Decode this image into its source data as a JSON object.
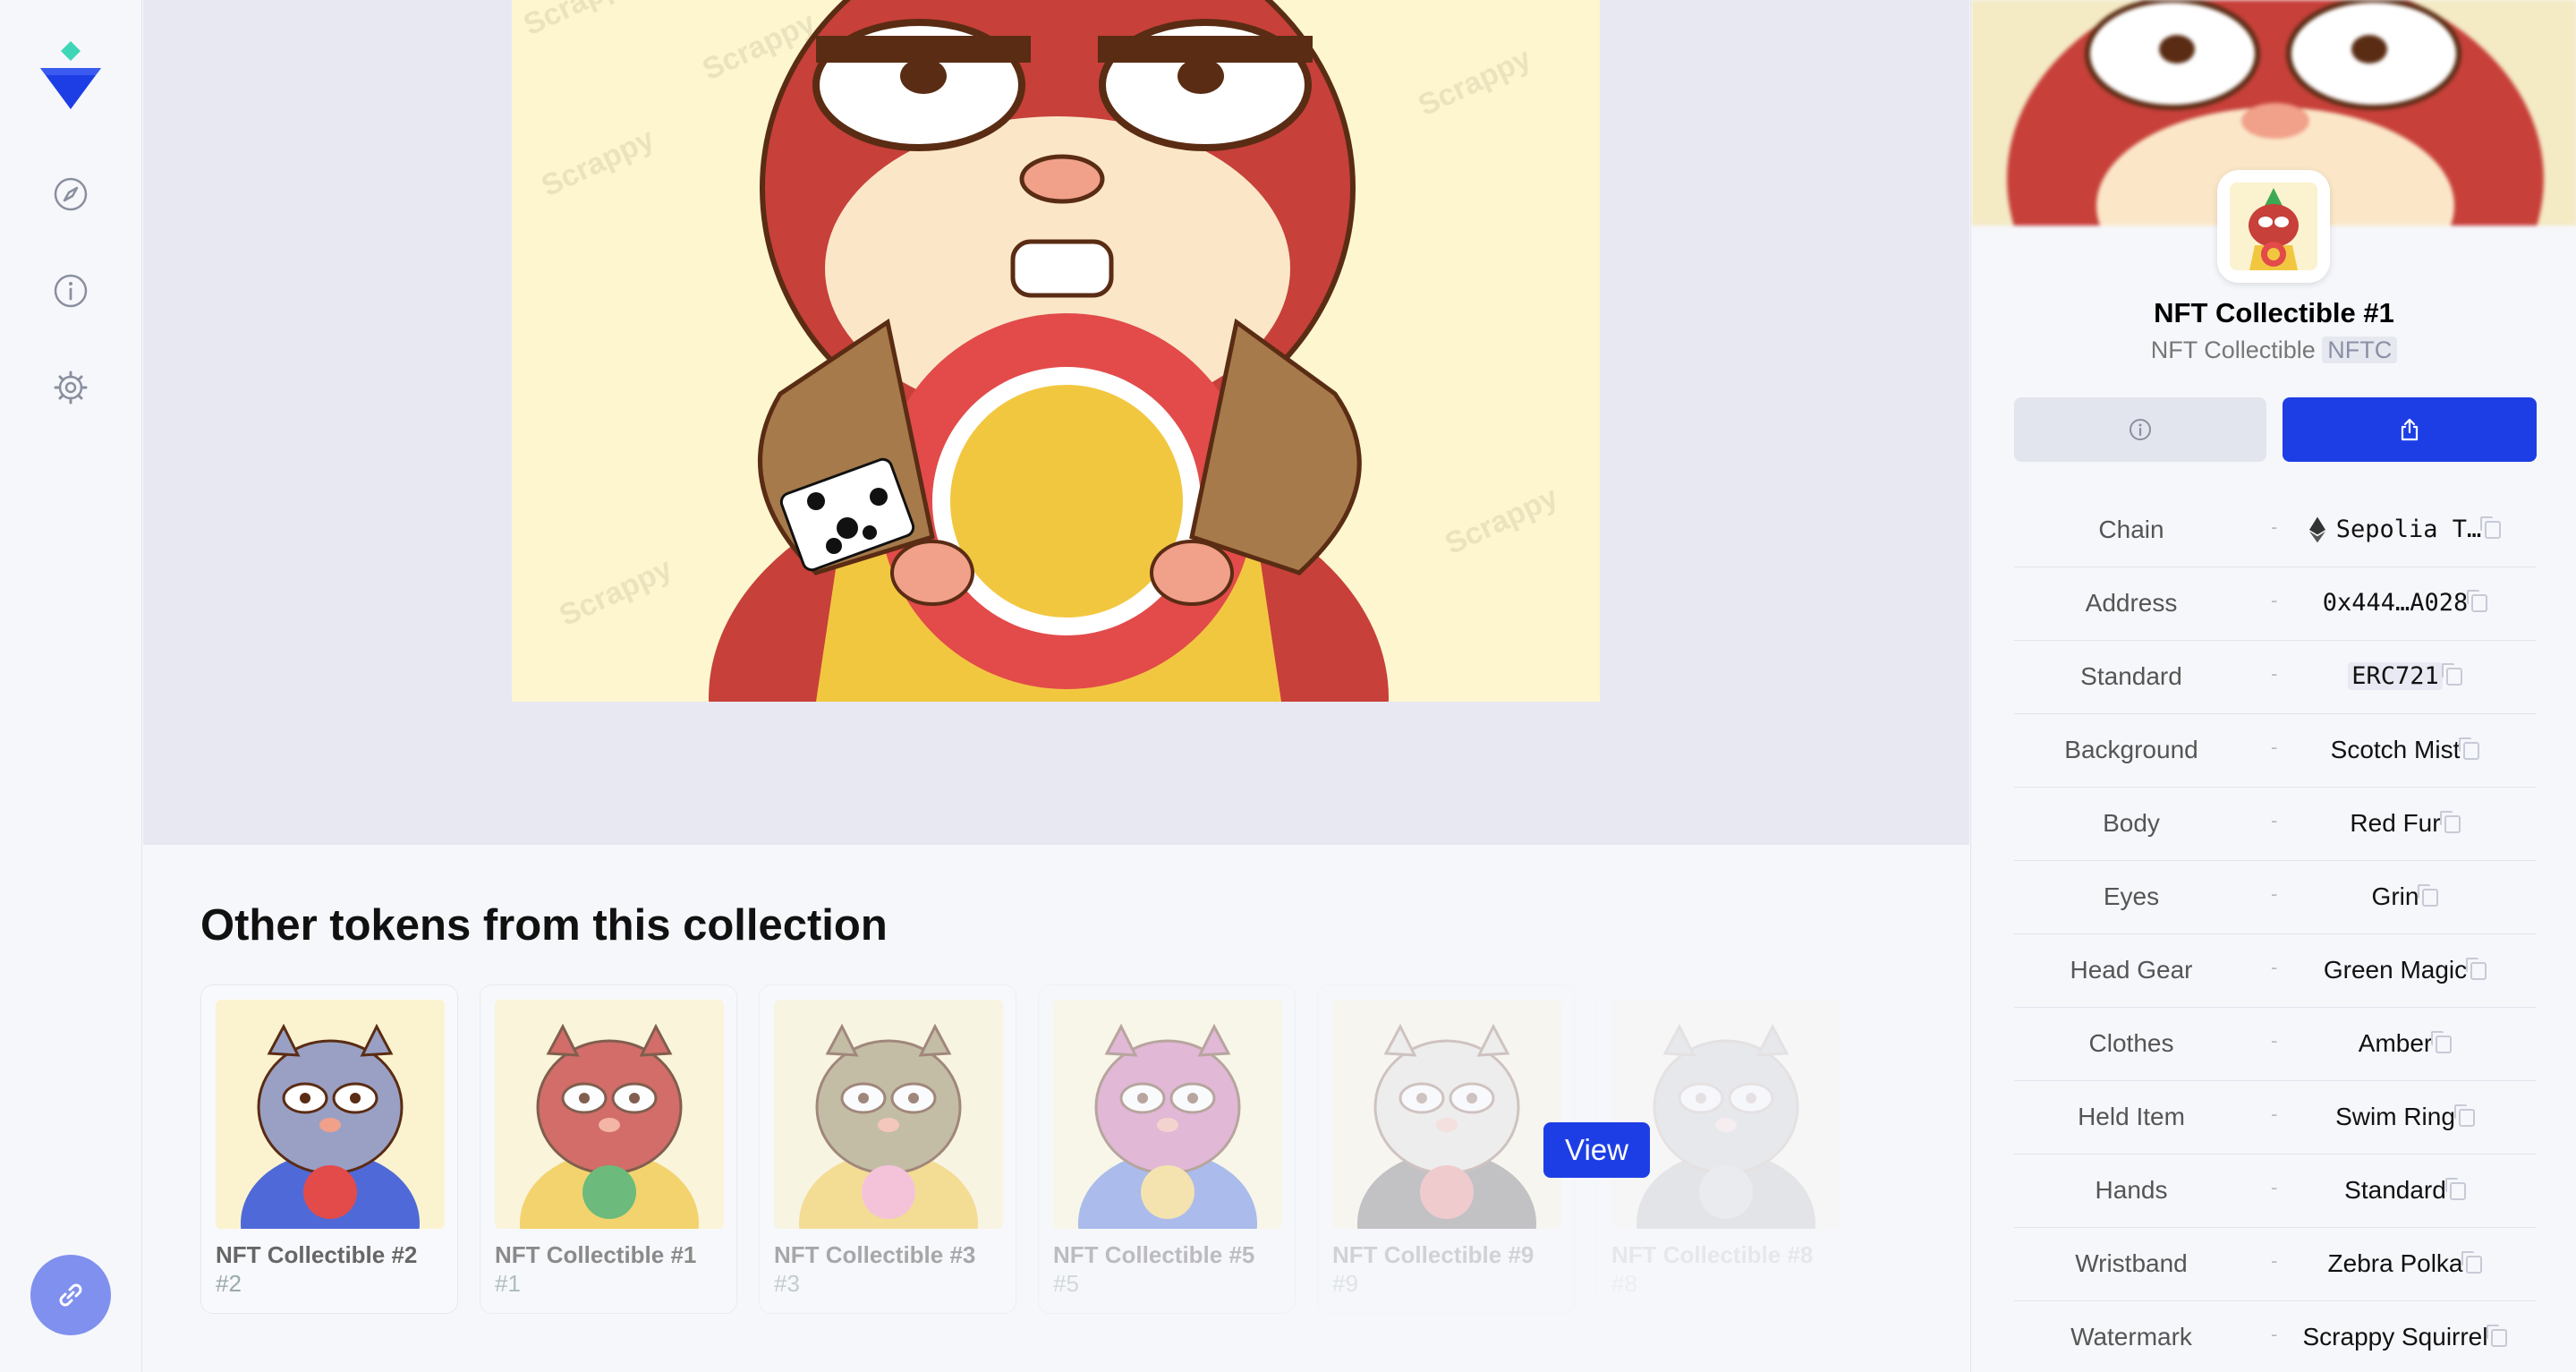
{
  "sidebar": {
    "icons": [
      "logo-icon",
      "compass-icon",
      "info-icon",
      "gear-icon",
      "link-icon"
    ]
  },
  "others": {
    "title": "Other tokens from this collection",
    "view_label": "View",
    "tokens": [
      {
        "name": "NFT Collectible #2",
        "id": "#2",
        "opacity": 1.0
      },
      {
        "name": "NFT Collectible #1",
        "id": "#1",
        "opacity": 0.75
      },
      {
        "name": "NFT Collectible #3",
        "id": "#3",
        "opacity": 0.55
      },
      {
        "name": "NFT Collectible #5",
        "id": "#5",
        "opacity": 0.4
      },
      {
        "name": "NFT Collectible #9",
        "id": "#9",
        "opacity": 0.25
      },
      {
        "name": "NFT Collectible #8",
        "id": "#8",
        "opacity": 0.1
      }
    ]
  },
  "hero": {
    "watermark": "Scrappy Squirrels"
  },
  "panel": {
    "title": "NFT Collectible #1",
    "collection": "NFT Collectible",
    "symbol": "NFTC",
    "properties": [
      {
        "key": "Chain",
        "value": "Sepolia T…"
      },
      {
        "key": "Address",
        "value": "0x444…A028"
      },
      {
        "key": "Standard",
        "value": "ERC721"
      },
      {
        "key": "Background",
        "value": "Scotch Mist"
      },
      {
        "key": "Body",
        "value": "Red Fur"
      },
      {
        "key": "Eyes",
        "value": "Grin"
      },
      {
        "key": "Head Gear",
        "value": "Green Magic"
      },
      {
        "key": "Clothes",
        "value": "Amber"
      },
      {
        "key": "Held Item",
        "value": "Swim Ring"
      },
      {
        "key": "Hands",
        "value": "Standard"
      },
      {
        "key": "Wristband",
        "value": "Zebra Polka"
      },
      {
        "key": "Watermark",
        "value": "Scrappy Squirrel"
      }
    ]
  },
  "colors": {
    "accent": "#1e3ee5",
    "fab": "#8090ee",
    "logo_top": "#3fd6b8",
    "logo_bottom": "#1e3ee5"
  }
}
